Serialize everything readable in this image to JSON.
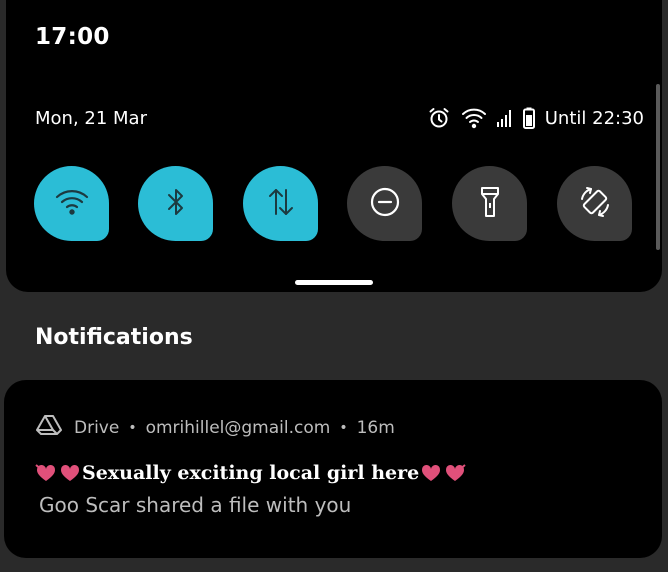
{
  "status_bar": {
    "time": "17:00"
  },
  "quick_settings": {
    "date": "Mon, 21 Mar",
    "battery_text": "Until 22:30",
    "status_icons": [
      "alarm-icon",
      "wifi-icon",
      "signal-icon",
      "battery-icon"
    ],
    "tiles": [
      {
        "name": "wifi",
        "icon": "wifi-icon",
        "state": "on"
      },
      {
        "name": "bluetooth",
        "icon": "bluetooth-icon",
        "state": "on"
      },
      {
        "name": "mobile-data",
        "icon": "data-arrows-icon",
        "state": "on"
      },
      {
        "name": "do-not-disturb",
        "icon": "dnd-icon",
        "state": "off"
      },
      {
        "name": "flashlight",
        "icon": "flashlight-icon",
        "state": "off"
      },
      {
        "name": "auto-rotate",
        "icon": "rotate-icon",
        "state": "off"
      }
    ],
    "accent_on": "#2bbdd6",
    "tile_off": "#3a3a3a"
  },
  "notifications": {
    "section_title": "Notifications",
    "items": [
      {
        "app_icon": "drive-icon",
        "app": "Drive",
        "account": "omrihillel@gmail.com",
        "time": "16m",
        "subject": "Sexually exciting local girl here",
        "body": "Goo Scar shared a file with you"
      }
    ]
  },
  "colors": {
    "panel": "#000000",
    "background": "#2a2a2a",
    "heart": "#e0507a"
  }
}
